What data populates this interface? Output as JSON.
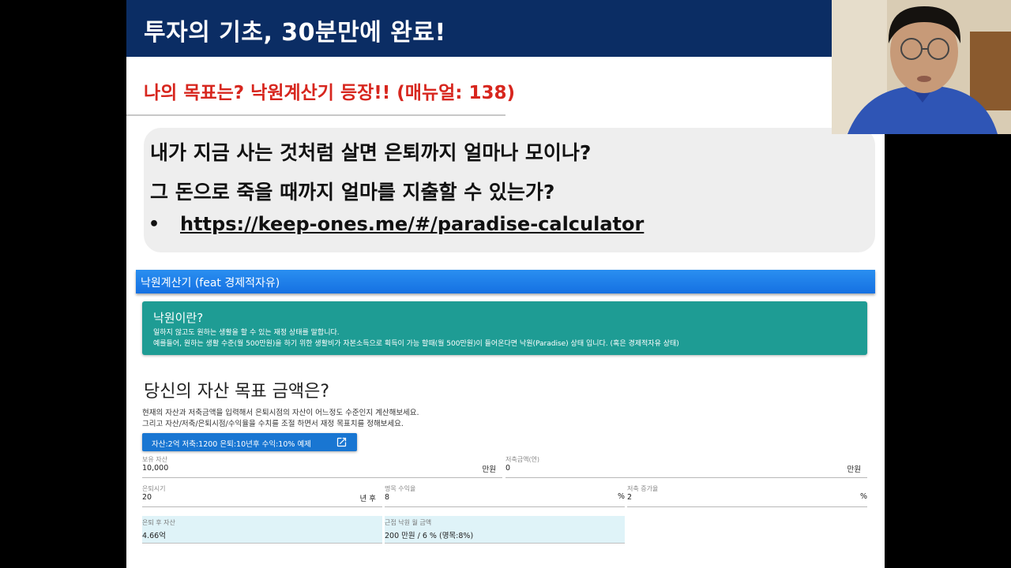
{
  "slide": {
    "title": "투자의 기초, 30분만에 완료!",
    "subtitle": "나의 목표는? 낙원계산기 등장!! (매뉴얼: 138)",
    "callout": {
      "question1": "내가 지금 사는 것처럼 살면 은퇴까지 얼마나 모이나?",
      "question2": "그 돈으로 죽을 때까지 얼마를 지출할 수 있는가?",
      "bullet": "•",
      "link": "https://keep-ones.me/#/paradise-calculator"
    }
  },
  "app": {
    "header_title": "낙원계산기 (feat 경제적자유)",
    "info": {
      "title": "낙원이란?",
      "line1": "일하지 않고도 원하는 생활을 할 수 있는 재정 상태를 말합니다.",
      "line2": "예를들어, 원하는 생활 수준(월 500만원)을 하기 위한 생활비가 자본소득으로 획득이 가능 할때(월 500만원)이 들어온다면 낙원(Paradise) 상태 입니다. (혹은 경제적자유 상태)"
    },
    "heading": "당신의 자산 목표 금액은?",
    "description1": "현재의 자산과 저축금액을 입력해서 은퇴시점의 자산이 어느정도 수준인지 계산해보세요.",
    "description2": "그리고 자산/저축/은퇴시점/수익율을 수치를 조절 하면서 재정 목표치를 정해보세요.",
    "example_button": "자산:2억 저축:1200 은퇴:10년후 수익:10% 예제",
    "fields": {
      "assets": {
        "label": "보유 자산",
        "value": "10,000",
        "unit": "만원"
      },
      "savings": {
        "label": "저축금액(연)",
        "value": "0",
        "unit": "만원"
      },
      "retire": {
        "label": "은퇴시기",
        "value": "20",
        "unit": "년 후"
      },
      "return_rate": {
        "label": "명목 수익율",
        "value": "8",
        "unit": "%"
      },
      "savings_growth": {
        "label": "저축 증가율",
        "value": "2",
        "unit": "%"
      }
    },
    "results": {
      "after_retire": {
        "label": "은퇴 후 자산",
        "value": "4.66억"
      },
      "paradise": {
        "label": "근접 낙원 월 금액",
        "value": "200 만원 / 6 % (명목:8%)"
      }
    }
  },
  "colors": {
    "title_bar": "#0b2d64",
    "subtitle_red": "#d7261e",
    "app_header_blue": "#1e88e5",
    "info_teal": "#1e9c94",
    "button_blue": "#1976d2",
    "result_bg": "#dff3f8"
  },
  "icons": {
    "example_button_icon": "open-in-new-icon"
  }
}
